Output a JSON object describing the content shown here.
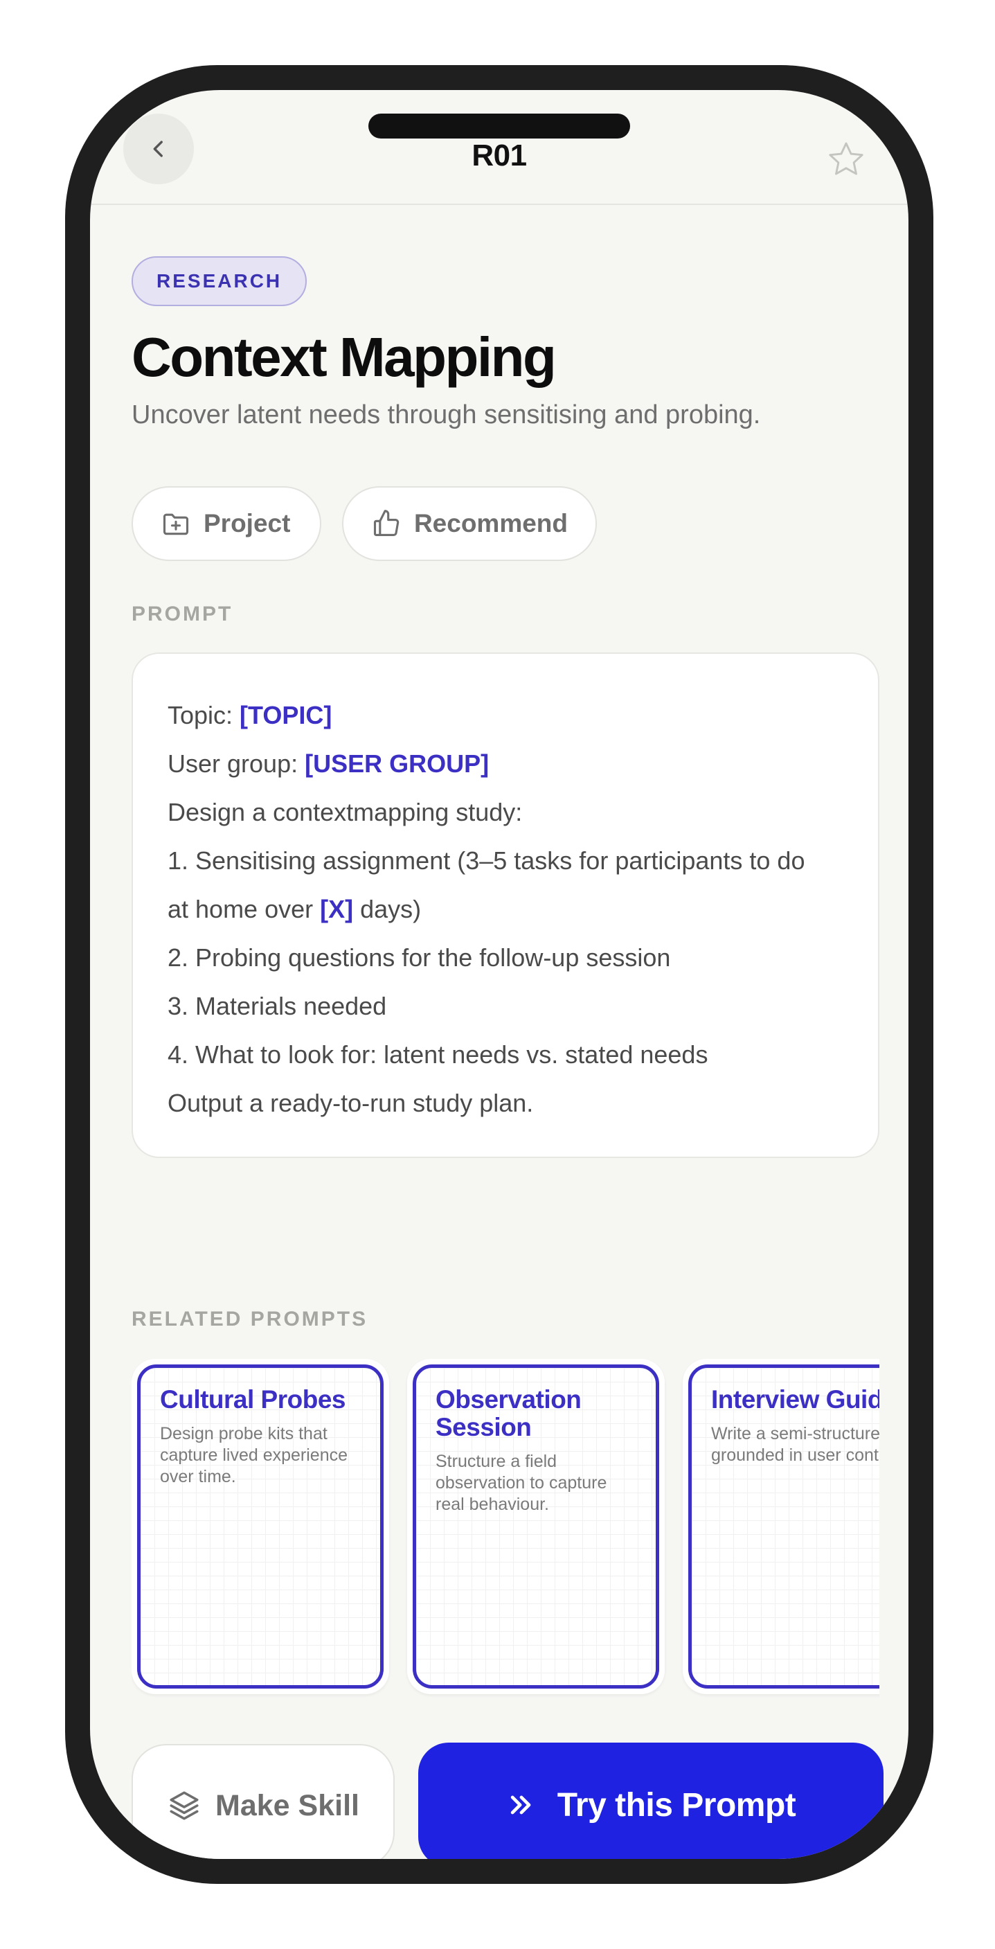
{
  "header": {
    "title": "R01",
    "back_icon": "chevron-left-icon",
    "favorite_icon": "star-outline-icon"
  },
  "category_badge": "RESEARCH",
  "title": "Context Mapping",
  "subtitle": "Uncover latent needs through sensitising and probing.",
  "actions": [
    {
      "label": "Project",
      "icon": "folder-plus-icon"
    },
    {
      "label": "Recommend",
      "icon": "thumbs-up-icon"
    }
  ],
  "prompt_section_label": "PROMPT",
  "prompt": {
    "line1_prefix": "Topic: ",
    "line1_var": "[TOPIC]",
    "line2_prefix": "User group: ",
    "line2_var": "[USER GROUP]",
    "line3": "Design a contextmapping study:",
    "line4": "1. Sensitising assignment (3–5 tasks for participants to do",
    "line5_prefix": "at home over ",
    "line5_var": "[X]",
    "line5_suffix": " days)",
    "line6": "2. Probing questions for the follow-up session",
    "line7": "3. Materials needed",
    "line8": "4. What to look for: latent needs vs. stated needs",
    "line9": "Output a ready-to-run study plan."
  },
  "related_section_label": "RELATED PROMPTS",
  "related": [
    {
      "title": "Cultural Probes",
      "description": "Design probe kits that capture lived experience over time."
    },
    {
      "title": "Observation Session",
      "description": "Structure a field observation to capture real behaviour."
    },
    {
      "title": "Interview Guide",
      "description": "Write a semi-structured guide grounded in user context."
    }
  ],
  "footer": {
    "make_skill_label": "Make Skill",
    "make_skill_icon": "layers-icon",
    "try_label": "Try this Prompt",
    "try_icon": "double-chevron-right-icon"
  },
  "colors": {
    "accent": "#3b2fc4",
    "primary_button": "#1f22e0",
    "background": "#f6f6f3"
  }
}
